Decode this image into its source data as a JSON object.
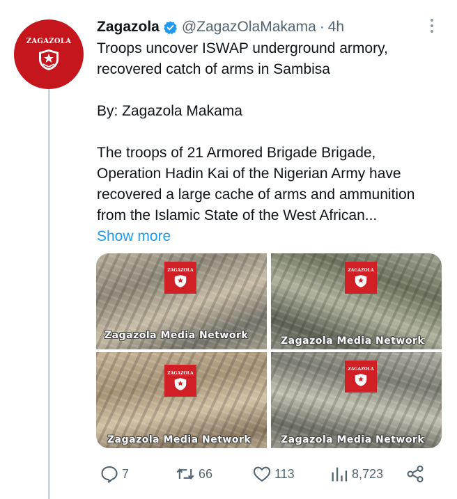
{
  "author": {
    "name": "Zagazola",
    "handle": "@ZagazOlaMakama",
    "time": "4h",
    "separator": "·",
    "avatar_text": "ZAGAZOLA",
    "verified_icon": "verified-badge-icon",
    "brand_color": "#c4161c"
  },
  "tweet": {
    "line1": "Troops uncover ISWAP underground armory,",
    "line2": "recovered catch of arms in Sambisa",
    "byline": "By: Zagazola Makama",
    "body1": "The troops of 21 Armored Brigade Brigade,",
    "body2": "Operation Hadin Kai of the Nigerian Army have",
    "body3": "recovered a large cache of arms and ammunition",
    "body4": "from the Islamic State of the West African...",
    "show_more": "Show more"
  },
  "media": [
    {
      "logo_text": "ZAGAZOLA",
      "caption": "Zagazola Media Network"
    },
    {
      "logo_text": "ZAGAZOLA",
      "caption": "Zagazola Media Network"
    },
    {
      "logo_text": "ZAGAZOLA",
      "caption": "Zagazola Media Network"
    },
    {
      "logo_text": "ZAGAZOLA",
      "caption": "Zagazola Media Network"
    }
  ],
  "actions": {
    "replies": "7",
    "retweets": "66",
    "likes": "113",
    "views": "8,723"
  },
  "colors": {
    "link": "#1d9bf0",
    "verified": "#1d9bf0",
    "muted": "#536471",
    "text": "#0f1419"
  }
}
